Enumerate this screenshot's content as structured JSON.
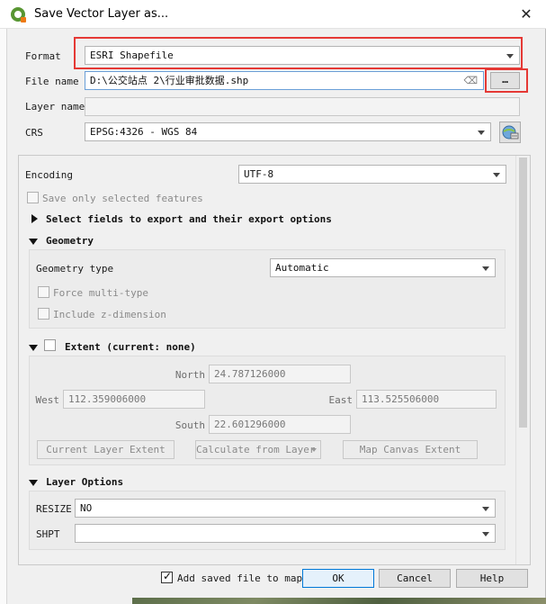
{
  "window": {
    "title": "Save Vector Layer as..."
  },
  "format": {
    "label": "Format",
    "value": "ESRI Shapefile"
  },
  "file_name": {
    "label": "File name",
    "value": "D:\\公交站点 2\\行业审批数据.shp",
    "browse_label": "…"
  },
  "layer_name": {
    "label": "Layer name",
    "value": ""
  },
  "crs": {
    "label": "CRS",
    "value": "EPSG:4326 - WGS 84"
  },
  "encoding": {
    "label": "Encoding",
    "value": "UTF-8"
  },
  "save_selected": {
    "label": "Save only selected features",
    "checked": false
  },
  "select_fields": {
    "label": "Select fields to export and their export options",
    "expanded": false
  },
  "geometry": {
    "label": "Geometry",
    "type_label": "Geometry type",
    "type_value": "Automatic",
    "force_multi": "Force multi-type",
    "include_z": "Include z-dimension"
  },
  "extent": {
    "label": "Extent (current: none)",
    "north_label": "North",
    "north": "24.787126000",
    "west_label": "West",
    "west": "112.359006000",
    "east_label": "East",
    "east": "113.525506000",
    "south_label": "South",
    "south": "22.601296000",
    "current_layer_btn": "Current Layer Extent",
    "calc_from_layer_btn": "Calculate from Layer",
    "map_canvas_btn": "Map Canvas Extent"
  },
  "layer_options": {
    "label": "Layer Options",
    "resize_label": "RESIZE",
    "resize_value": "NO",
    "shpt_label": "SHPT",
    "shpt_value": ""
  },
  "footer": {
    "add_saved": "Add saved file to map",
    "add_saved_checked": true,
    "ok": "OK",
    "cancel": "Cancel",
    "help": "Help"
  },
  "colors": {
    "highlight": "#e53935",
    "qgis_green": "#589632",
    "qgis_orange": "#ee7913",
    "ok_border": "#0078d7"
  }
}
